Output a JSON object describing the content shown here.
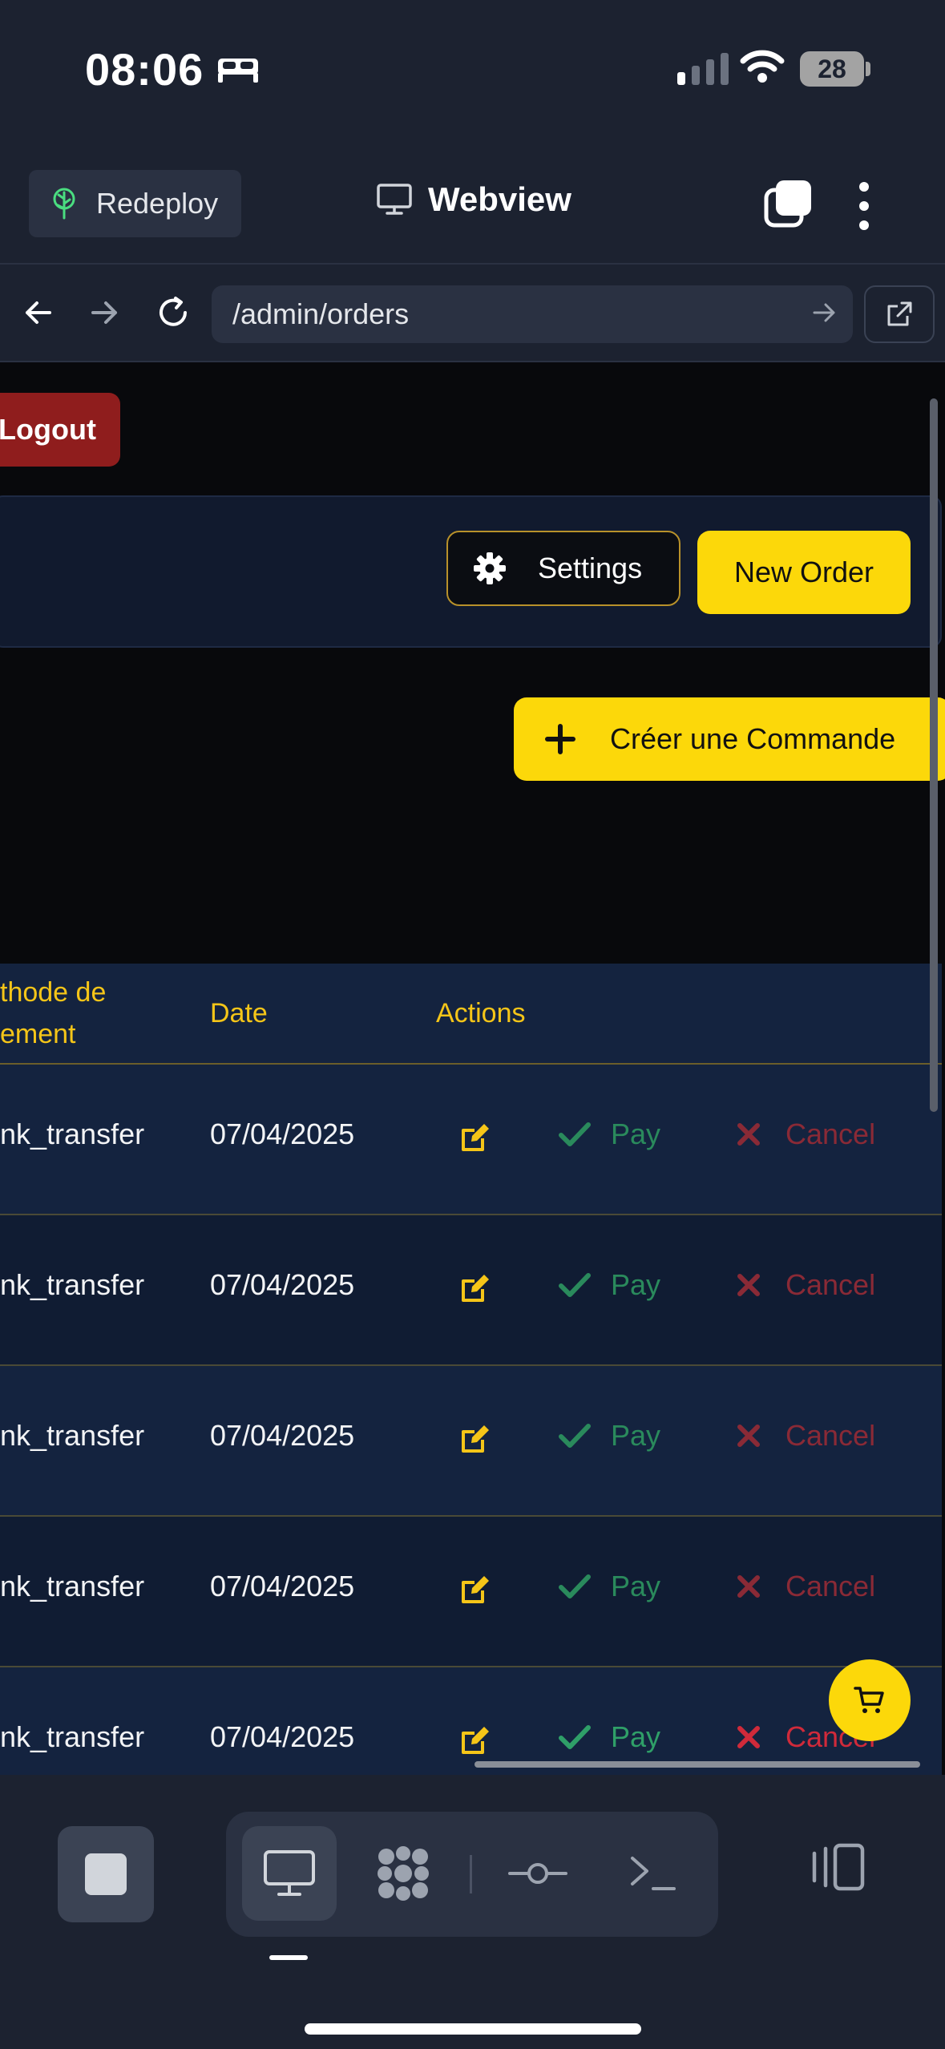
{
  "status_bar": {
    "time": "08:06",
    "battery": "28"
  },
  "header": {
    "redeploy_label": "Redeploy",
    "title": "Webview"
  },
  "urlbar": {
    "url": "/admin/orders"
  },
  "page": {
    "logout_label": "Logout",
    "settings_label": "Settings",
    "new_order_label": "New Order",
    "create_order_label": "Créer une Commande"
  },
  "table": {
    "columns": [
      {
        "label_line1": "thode de",
        "label_line2": "ement"
      },
      {
        "label": "Date"
      },
      {
        "label": "Actions"
      }
    ],
    "rows": [
      {
        "method": "nk_transfer",
        "date": "07/04/2025",
        "pay": "Pay",
        "cancel": "Cancel"
      },
      {
        "method": "nk_transfer",
        "date": "07/04/2025",
        "pay": "Pay",
        "cancel": "Cancel"
      },
      {
        "method": "nk_transfer",
        "date": "07/04/2025",
        "pay": "Pay",
        "cancel": "Cancel"
      },
      {
        "method": "nk_transfer",
        "date": "07/04/2025",
        "pay": "Pay",
        "cancel": "Cancel"
      },
      {
        "method": "nk_transfer",
        "date": "07/04/2025",
        "pay": "Pay",
        "cancel": "Cancel"
      }
    ]
  },
  "icons": {
    "redeploy": "tree-icon",
    "webview": "monitor-icon",
    "tabs": "tabs-icon",
    "more": "more-vertical-icon",
    "back": "arrow-left-icon",
    "forward": "arrow-right-icon",
    "reload": "reload-icon",
    "open_external": "external-link-icon",
    "settings": "gear-icon",
    "create": "plus-icon",
    "edit": "edit-icon",
    "pay": "check-icon",
    "cancel": "x-icon",
    "cart": "cart-icon"
  },
  "colors": {
    "accent": "#fcd80a",
    "logout": "#8f1d1d",
    "pay": "#2a8a5c",
    "cancel": "#8a2a36",
    "header_text": "#f5c518"
  }
}
